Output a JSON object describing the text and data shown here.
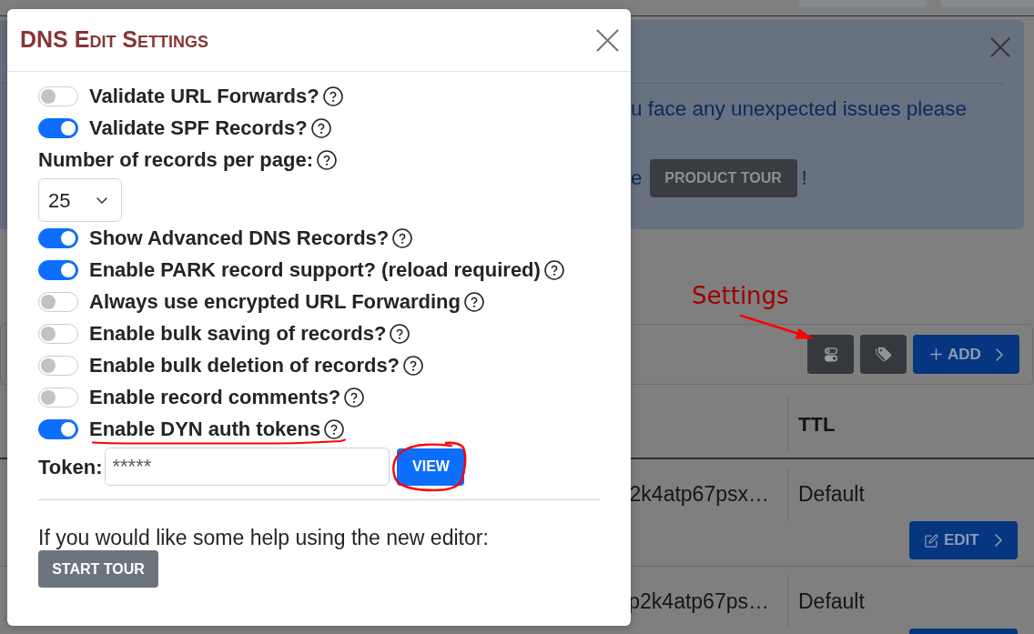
{
  "dialog": {
    "title": "DNS Edit Settings",
    "settings": [
      {
        "kind": "toggle",
        "label": "Validate URL Forwards?",
        "on": false
      },
      {
        "kind": "toggle",
        "label": "Validate SPF Records?",
        "on": true
      },
      {
        "kind": "select",
        "label": "Number of records per page:",
        "value": "25"
      },
      {
        "kind": "toggle",
        "label": "Show Advanced DNS Records?",
        "on": true
      },
      {
        "kind": "toggle",
        "label": "Enable PARK record support? (reload required)",
        "on": true
      },
      {
        "kind": "toggle",
        "label": "Always use encrypted URL Forwarding",
        "on": false
      },
      {
        "kind": "toggle",
        "label": "Enable bulk saving of records?",
        "on": false
      },
      {
        "kind": "toggle",
        "label": "Enable bulk deletion of records?",
        "on": false
      },
      {
        "kind": "toggle",
        "label": "Enable record comments?",
        "on": false
      },
      {
        "kind": "toggle",
        "label": "Enable DYN auth tokens",
        "on": true
      }
    ],
    "token": {
      "label": "Token:",
      "value": "*****",
      "button": "VIEW"
    },
    "help_text": "If you would like some help using the new editor:",
    "tour_button": "START TOUR"
  },
  "alert": {
    "line_1": "u face any unexpected issues please",
    "line_2_start": "e",
    "tour_button": "PRODUCT TOUR",
    "line_2_end": "!"
  },
  "annotation": {
    "label": "Settings"
  },
  "toolbar": {
    "add_button": "ADD"
  },
  "table": {
    "ttl_heading": "TTL",
    "rows": [
      {
        "column_1": "2k4atp67psx…",
        "ttl": "Default",
        "edit_button": "EDIT"
      },
      {
        "column_1": "p2k4atp67ps…",
        "ttl": "Default"
      }
    ]
  }
}
